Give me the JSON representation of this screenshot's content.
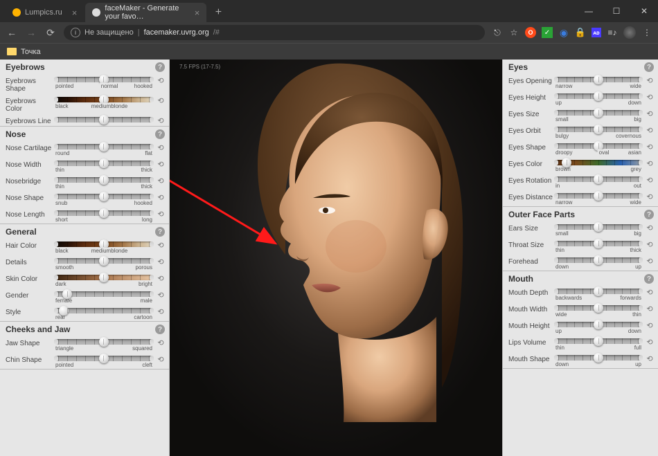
{
  "browser": {
    "tabs": [
      {
        "title": "Lumpics.ru",
        "active": false
      },
      {
        "title": "faceMaker - Generate your favo…",
        "active": true
      }
    ],
    "secure_label": "Не защищено",
    "url_host": "facemaker.uvrg.org",
    "url_path": "/#",
    "bookmark": "Точка"
  },
  "viewport": {
    "fps": "7.5 FPS (17-7.5)"
  },
  "left_panels": [
    {
      "title": "Eyebrows",
      "rows": [
        {
          "label": "Eyebrows Shape",
          "min": "pointed",
          "max": "hooked",
          "mid": "normal",
          "pos": 50
        },
        {
          "label": "Eyebrows Color",
          "min": "black",
          "max": "",
          "mid": "mediumblonde",
          "pos": 50,
          "track": "haircolor"
        },
        {
          "label": "Eyebrows Line",
          "min": "",
          "max": "",
          "pos": 50
        }
      ]
    },
    {
      "title": "Nose",
      "highlight": true,
      "rows": [
        {
          "label": "Nose Cartilage",
          "min": "round",
          "max": "flat",
          "pos": 50
        },
        {
          "label": "Nose Width",
          "min": "thin",
          "max": "thick",
          "pos": 50
        },
        {
          "label": "Nosebridge",
          "min": "thin",
          "max": "thick",
          "pos": 50
        },
        {
          "label": "Nose Shape",
          "min": "snub",
          "max": "hooked",
          "pos": 50
        },
        {
          "label": "Nose Length",
          "min": "short",
          "max": "long",
          "pos": 50
        }
      ]
    },
    {
      "title": "General",
      "rows": [
        {
          "label": "Hair Color",
          "min": "black",
          "max": "",
          "mid": "mediumblonde",
          "pos": 50,
          "track": "haircolor"
        },
        {
          "label": "Details",
          "min": "smooth",
          "max": "porous",
          "pos": 50
        },
        {
          "label": "Skin Color",
          "min": "dark",
          "max": "bright",
          "pos": 50,
          "track": "skincolor"
        },
        {
          "label": "Gender",
          "min": "female",
          "max": "male",
          "pos": 13
        },
        {
          "label": "Style",
          "min": "real",
          "max": "cartoon",
          "pos": 10
        }
      ]
    },
    {
      "title": "Cheeks and Jaw",
      "rows": [
        {
          "label": "Jaw Shape",
          "min": "triangle",
          "max": "squared",
          "pos": 50
        },
        {
          "label": "Chin Shape",
          "min": "pointed",
          "max": "cleft",
          "pos": 50
        }
      ]
    }
  ],
  "right_panels": [
    {
      "title": "Eyes",
      "rows": [
        {
          "label": "Eyes Opening",
          "min": "narrow",
          "max": "wide",
          "pos": 50
        },
        {
          "label": "Eyes Height",
          "min": "up",
          "max": "down",
          "pos": 50
        },
        {
          "label": "Eyes Size",
          "min": "small",
          "max": "big",
          "pos": 50
        },
        {
          "label": "Eyes Orbit",
          "min": "bulgy",
          "max": "covernous",
          "pos": 50
        },
        {
          "label": "Eyes Shape",
          "min": "droopy",
          "max": "asian",
          "mid": "oval",
          "pos": 50
        },
        {
          "label": "Eyes Color",
          "min": "brown",
          "max": "grey",
          "pos": 14,
          "track": "eyecolor"
        },
        {
          "label": "Eyes Rotation",
          "min": "in",
          "max": "out",
          "pos": 50
        },
        {
          "label": "Eyes Distance",
          "min": "narrow",
          "max": "wide",
          "pos": 50
        }
      ]
    },
    {
      "title": "Outer Face Parts",
      "rows": [
        {
          "label": "Ears Size",
          "min": "small",
          "max": "big",
          "pos": 50
        },
        {
          "label": "Throat Size",
          "min": "thin",
          "max": "thick",
          "pos": 50
        },
        {
          "label": "Forehead",
          "min": "down",
          "max": "up",
          "pos": 50
        }
      ]
    },
    {
      "title": "Mouth",
      "rows": [
        {
          "label": "Mouth Depth",
          "min": "backwards",
          "max": "forwards",
          "pos": 50
        },
        {
          "label": "Mouth Width",
          "min": "wide",
          "max": "thin",
          "pos": 50
        },
        {
          "label": "Mouth Height",
          "min": "up",
          "max": "down",
          "pos": 50
        },
        {
          "label": "Lips Volume",
          "min": "thin",
          "max": "full",
          "pos": 50
        },
        {
          "label": "Mouth Shape",
          "min": "down",
          "max": "up",
          "pos": 50
        }
      ]
    }
  ]
}
